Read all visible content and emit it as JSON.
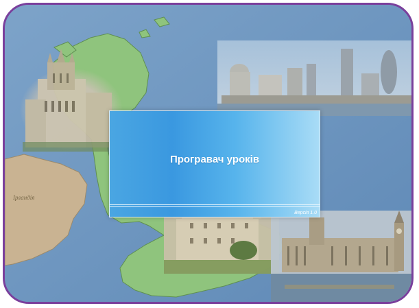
{
  "splash": {
    "title": "Програвач уроків",
    "version": "Версія 1.0"
  },
  "map": {
    "ireland_label": "Ірландія"
  },
  "colors": {
    "frame_border": "#7a3f9c",
    "sea": "#6f96bf",
    "land_green": "#8fc47d",
    "land_tan": "#c9b392",
    "splash_blue": "#3a98e0"
  },
  "icons": [
    "building-photo",
    "map"
  ]
}
